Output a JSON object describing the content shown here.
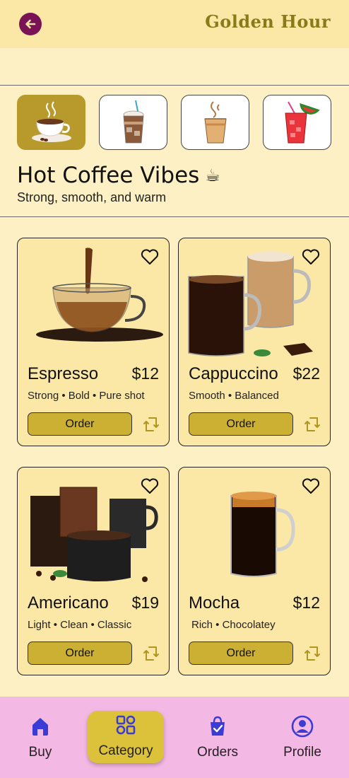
{
  "header": {
    "title": "Golden Hour"
  },
  "categories": [
    {
      "name": "hot-coffee",
      "icon": "hot-coffee-cup-icon",
      "active": true
    },
    {
      "name": "iced-coffee",
      "icon": "iced-coffee-cup-icon",
      "active": false
    },
    {
      "name": "latte",
      "icon": "latte-glass-icon",
      "active": false
    },
    {
      "name": "juice",
      "icon": "watermelon-juice-icon",
      "active": false
    }
  ],
  "section": {
    "title": "Hot Coffee Vibes",
    "emoji": "☕",
    "subtitle": "Strong, smooth, and warm"
  },
  "products": [
    {
      "name": "Espresso",
      "price": "$12",
      "desc": "Strong • Bold • Pure shot",
      "order": "Order"
    },
    {
      "name": "Cappuccino",
      "price": "$22",
      "desc": "Smooth • Balanced",
      "order": "Order"
    },
    {
      "name": "Americano",
      "price": "$19",
      "desc": "Light • Clean • Classic",
      "order": "Order"
    },
    {
      "name": "Mocha",
      "price": "$12",
      "desc": "Rich • Chocolatey",
      "order": "Order"
    }
  ],
  "nav": [
    {
      "label": "Buy",
      "icon": "home-icon"
    },
    {
      "label": "Category",
      "icon": "grid-icon"
    },
    {
      "label": "Orders",
      "icon": "shopping-bag-icon"
    },
    {
      "label": "Profile",
      "icon": "profile-icon"
    }
  ],
  "colors": {
    "accent": "#cbb034",
    "header": "#fbe7a6",
    "nav": "#f4b8e4",
    "back": "#7a1356",
    "navIcon": "#3b3bd6"
  }
}
